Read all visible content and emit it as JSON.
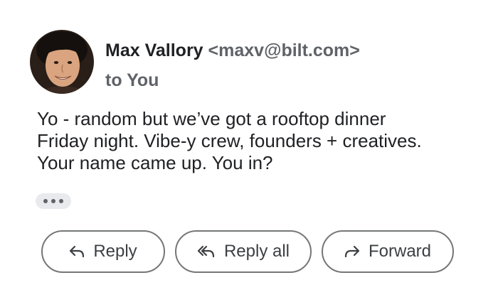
{
  "message": {
    "sender": {
      "name": "Max Vallory",
      "email": "<maxv@bilt.com>"
    },
    "recipient_line": "to You",
    "body": [
      "Yo - random but we’ve got a rooftop dinner",
      "Friday night. Vibe-y crew, founders + creatives.",
      "Your name came up. You in?"
    ],
    "more_icon": "more-horiz-icon"
  },
  "actions": {
    "reply": {
      "label": "Reply",
      "icon": "reply-icon"
    },
    "reply_all": {
      "label": "Reply all",
      "icon": "reply-all-icon"
    },
    "forward": {
      "label": "Forward",
      "icon": "forward-icon"
    }
  },
  "colors": {
    "text_primary": "#202124",
    "text_secondary": "#5f6368",
    "button_border": "#747775",
    "chip_background": "#e8eaed"
  }
}
